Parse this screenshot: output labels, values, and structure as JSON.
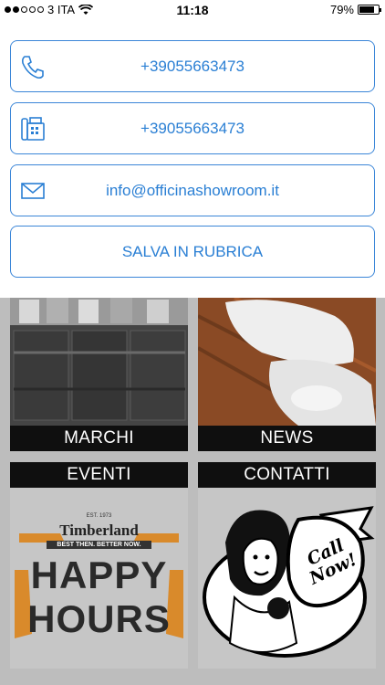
{
  "status_bar": {
    "carrier": "3 ITA",
    "time": "11:18",
    "battery": "79%",
    "battery_level": 0.79,
    "signal_bars": 2
  },
  "contacts": {
    "phone": {
      "label": "+39055663473",
      "icon": "phone-icon"
    },
    "fax": {
      "label": "+39055663473",
      "icon": "fax-icon"
    },
    "email": {
      "label": "info@officinashowroom.it",
      "icon": "envelope-icon"
    },
    "save": {
      "label": "SALVA IN RUBRICA"
    }
  },
  "tiles": {
    "marchi": "MARCHI",
    "news": "NEWS",
    "eventi": "EVENTI",
    "contatti": "CONTATTI"
  },
  "timberland": {
    "brand": "Timberland",
    "est": "EST. 1973",
    "tagline": "BEST THEN. BETTER NOW.",
    "line1": "HAPPY",
    "line2": "HOURS"
  },
  "call_now": "Call Now!",
  "colors": {
    "accent": "#2a7fd4",
    "bar": "#0f0f0f",
    "background": "#bdbdbd"
  }
}
